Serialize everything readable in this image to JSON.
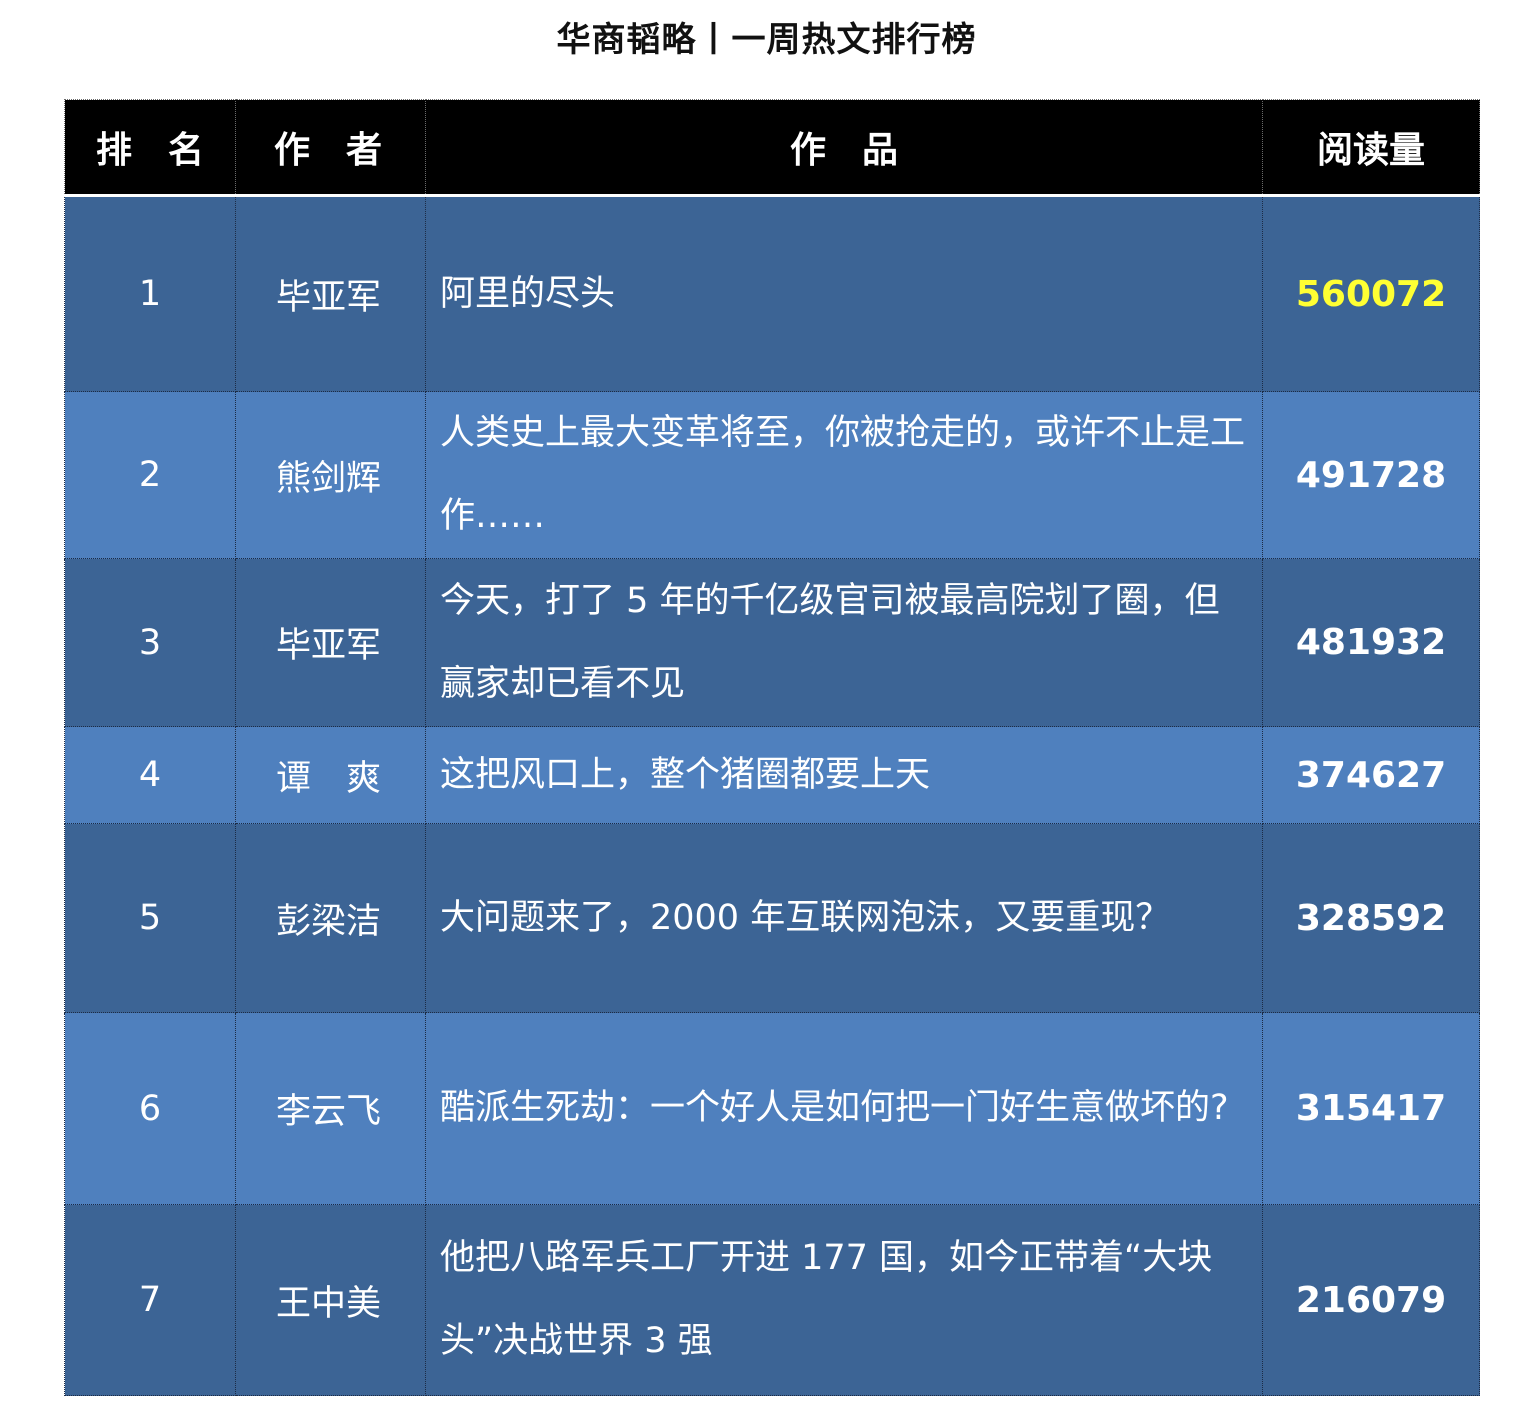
{
  "title": "华商韬略丨一周热文排行榜",
  "columns": {
    "rank": "排　名",
    "author": "作　者",
    "work": "作　品",
    "reads": "阅读量"
  },
  "rows": [
    {
      "rank": "1",
      "author": "毕亚军",
      "work": "阿里的尽头",
      "reads": "560072"
    },
    {
      "rank": "2",
      "author": "熊剑辉",
      "work": "人类史上最大变革将至，你被抢走的，或许不止是工作……",
      "reads": "491728"
    },
    {
      "rank": "3",
      "author": "毕亚军",
      "work": "今天，打了 5 年的千亿级官司被最高院划了圈，但赢家却已看不见",
      "reads": "481932"
    },
    {
      "rank": "4",
      "author": "谭　爽",
      "work": "这把风口上，整个猪圈都要上天",
      "reads": "374627"
    },
    {
      "rank": "5",
      "author": "彭梁洁",
      "work": "大问题来了，2000 年互联网泡沫，又要重现？",
      "reads": "328592"
    },
    {
      "rank": "6",
      "author": "李云飞",
      "work": "酷派生死劫：一个好人是如何把一门好生意做坏的?",
      "reads": "315417"
    },
    {
      "rank": "7",
      "author": "王中美",
      "work": "他把八路军兵工厂开进 177 国，如今正带着“大块头”决战世界 3 强",
      "reads": "216079"
    }
  ],
  "colors": {
    "header_bg": "#000000",
    "row_dark": "#3c6495",
    "row_light": "#4f80be",
    "top_reads": "#ffff33"
  }
}
